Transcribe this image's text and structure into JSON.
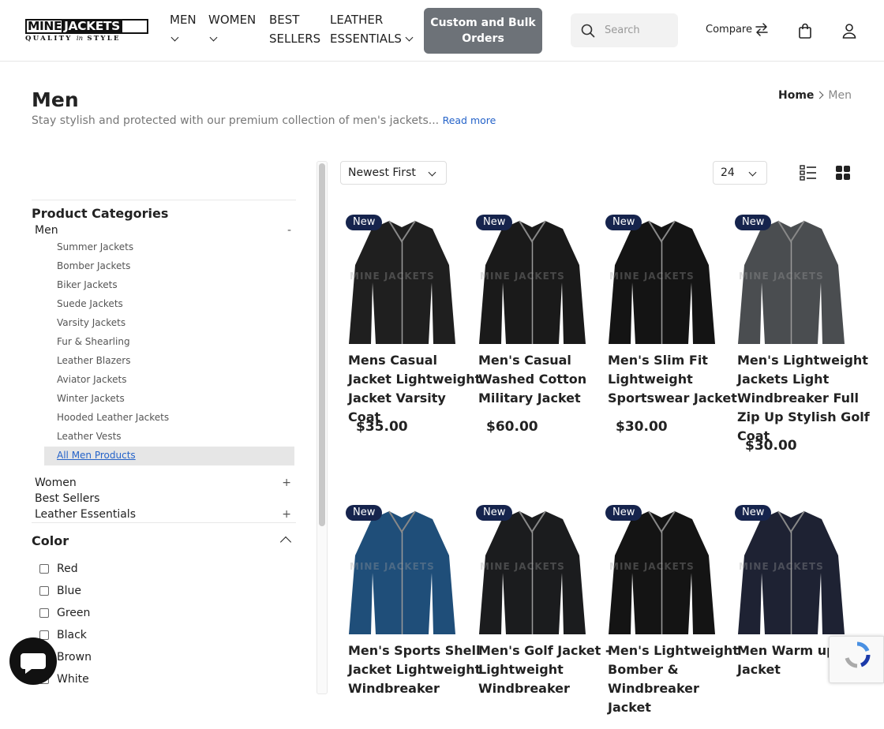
{
  "logo": {
    "text_main_a": "MINE",
    "text_main_b": "JACKETS",
    "tagline_a": "QUALITY",
    "tagline_b": "in",
    "tagline_c": "STYLE"
  },
  "header": {
    "nav": [
      {
        "label": "MEN"
      },
      {
        "label": "WOMEN"
      },
      {
        "label": "BEST SELLERS"
      },
      {
        "label": "LEATHER ESSENTIALS"
      }
    ],
    "custom_button": "Custom and Bulk Orders",
    "search_placeholder": "Search",
    "compare_label": "Compare"
  },
  "page": {
    "title": "Men",
    "description": "Stay stylish and protected with our premium collection of men's jackets...",
    "read_more": "Read more",
    "breadcrumb": {
      "home": "Home",
      "current": "Men"
    }
  },
  "sidebar": {
    "categories_title": "Product Categories",
    "categories": [
      {
        "label": "Men",
        "sign": "-"
      },
      {
        "label": "Women",
        "sign": "+"
      },
      {
        "label": "Best Sellers",
        "sign": ""
      },
      {
        "label": "Leather Essentials",
        "sign": "+"
      }
    ],
    "men_subcategories": [
      "Summer Jackets",
      "Bomber Jackets",
      "Biker Jackets",
      "Suede Jackets",
      "Varsity Jackets",
      "Fur & Shearling",
      "Leather Blazers",
      "Aviator Jackets",
      "Winter Jackets",
      "Hooded Leather Jackets",
      "Leather Vests"
    ],
    "active_subcategory": "All Men Products",
    "color_title": "Color",
    "colors": [
      "Red",
      "Blue",
      "Green",
      "Black",
      "Brown",
      "White"
    ]
  },
  "toolbar": {
    "sort_value": "Newest First",
    "per_page_value": "24"
  },
  "products": [
    {
      "badge": "New",
      "name": "Mens Casual Jacket Lightweight Jacket Varsity Coat",
      "price": "$35.00",
      "color": "#1f1f1f"
    },
    {
      "badge": "New",
      "name": "Men's Casual Washed Cotton Military Jacket",
      "price": "$60.00",
      "color": "#1a1a1a"
    },
    {
      "badge": "New",
      "name": "Men's Slim Fit Lightweight Sportswear Jacket",
      "price": "$30.00",
      "color": "#141414"
    },
    {
      "badge": "New",
      "name": "Men's Lightweight Jackets Light Windbreaker Full Zip Up Stylish Golf Coat",
      "price": "$30.00",
      "color": "#4a4d50"
    },
    {
      "badge": "New",
      "name": "Men's Sports Shell Jacket Lightweight Windbreaker",
      "price": "",
      "color": "#1f4e79"
    },
    {
      "badge": "New",
      "name": "Men's Golf Jacket - Lightweight Windbreaker",
      "price": "",
      "color": "#1b1c1e"
    },
    {
      "badge": "New",
      "name": "Men's Lightweight Bomber & Windbreaker Jacket",
      "price": "",
      "color": "#141414"
    },
    {
      "badge": "New",
      "name": "Men Warm up Jacket",
      "price": "",
      "color": "#1e2233"
    }
  ],
  "watermark": "MINE JACKETS"
}
